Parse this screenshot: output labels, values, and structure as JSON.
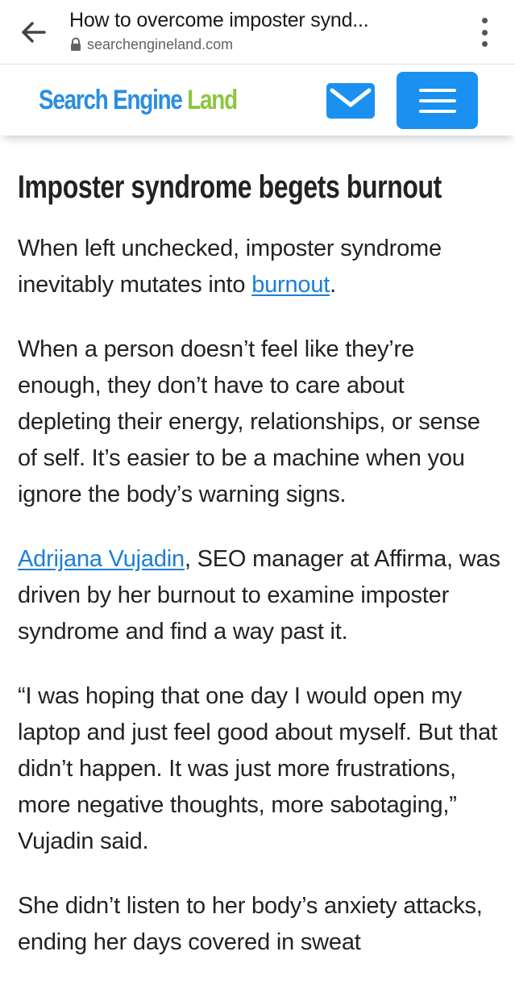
{
  "browser": {
    "tab_title": "How to overcome imposter synd...",
    "url": "searchengineland.com"
  },
  "site": {
    "logo_part1": "Search Engine ",
    "logo_part2": "Land",
    "colors": {
      "accent": "#1a91f0",
      "logo_blue": "#2a8ee0",
      "logo_green": "#8cc63f",
      "link": "#1a7fd6"
    },
    "icons": [
      "back-arrow-icon",
      "lock-icon",
      "more-vert-icon",
      "mail-icon",
      "hamburger-menu-icon"
    ]
  },
  "article": {
    "heading": "Imposter syndrome begets burnout",
    "p1_before": "When left unchecked, imposter syndrome inevitably mutates into ",
    "p1_link": "burnout",
    "p1_after": ".",
    "p2": "When a person doesn’t feel like they’re enough, they don’t have to care about depleting their energy, relationships, or sense of self. It’s easier to be a machine when you ignore the body’s warning signs.",
    "p3_link": "Adrijana Vujadin",
    "p3_after": ", SEO manager at Affirma, was driven by her burnout to examine imposter syndrome and find a way past it.",
    "p4": "“I was hoping that one day I would open my laptop and just feel good about myself. But that didn’t happen. It was just more frustrations, more negative thoughts, more sabotaging,” Vujadin said.",
    "p5": "She didn’t listen to her body’s anxiety attacks, ending her days covered in sweat"
  }
}
